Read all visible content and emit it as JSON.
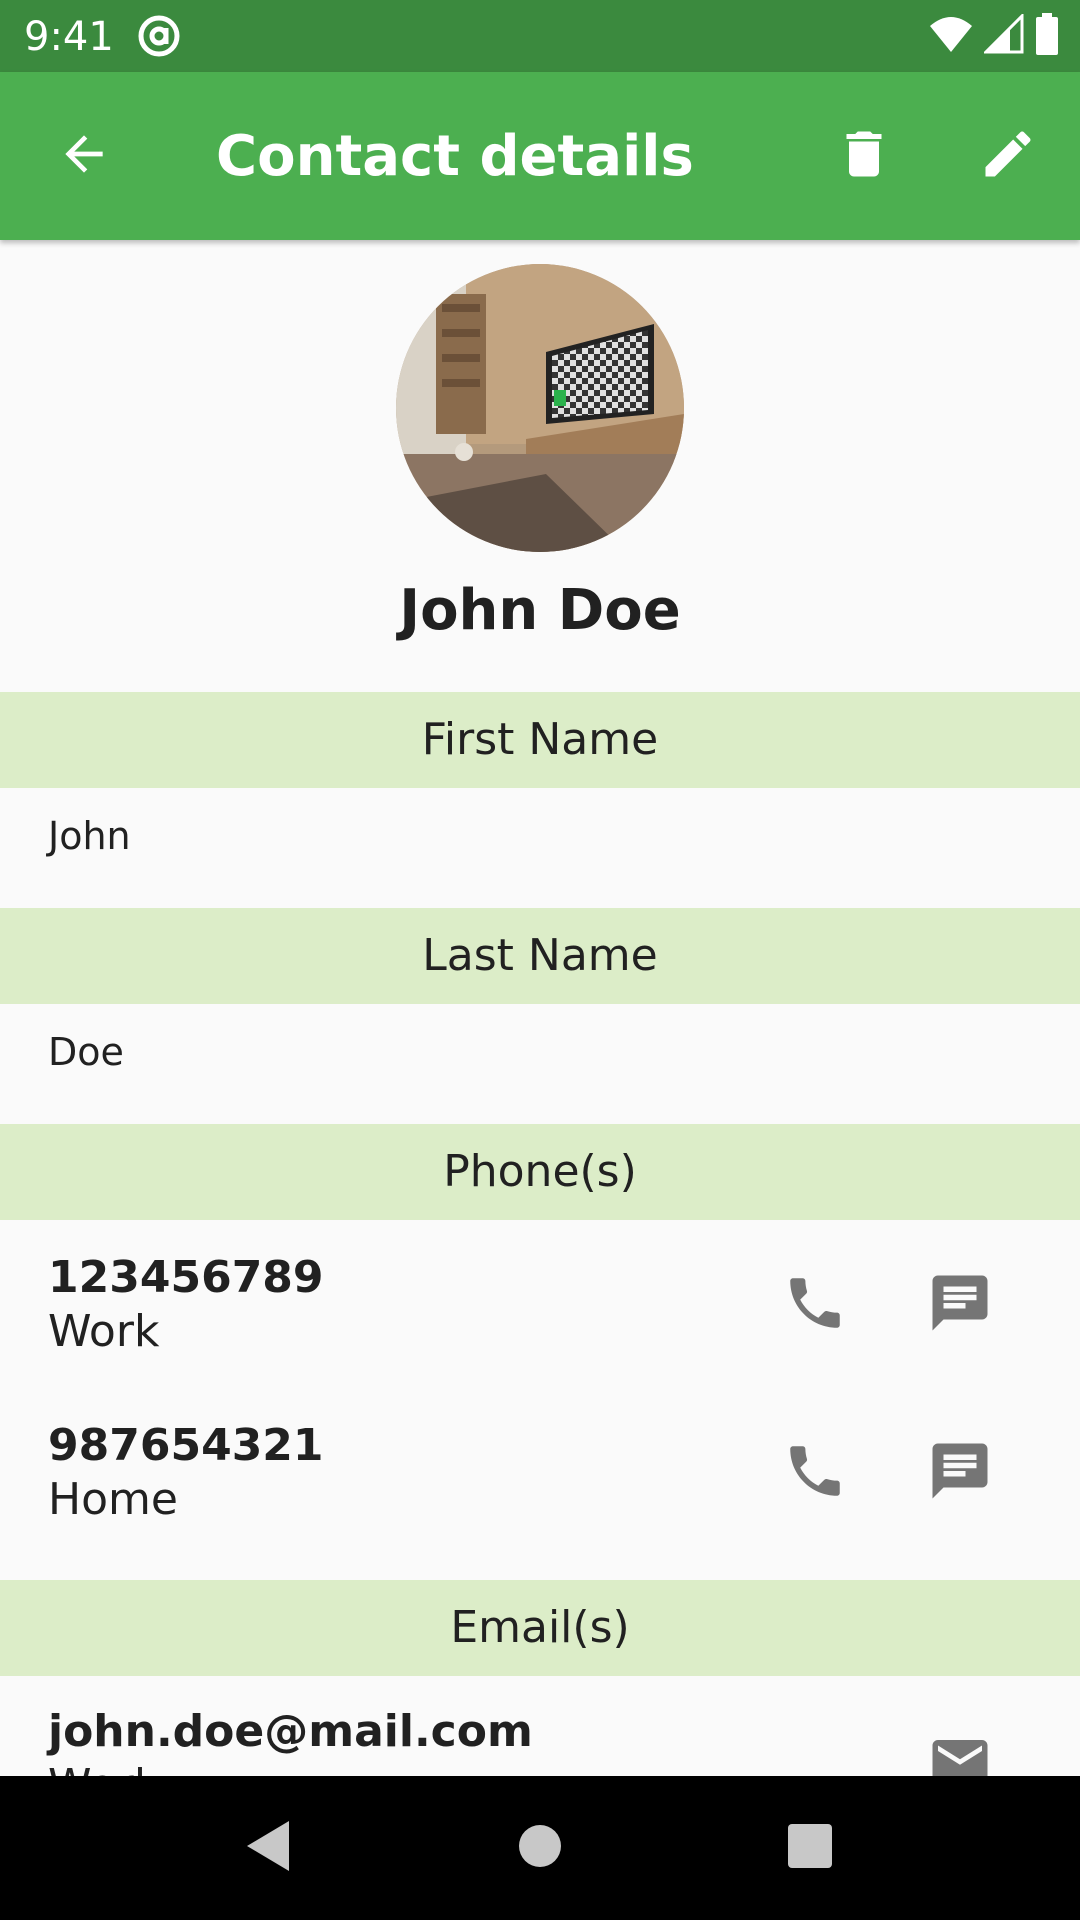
{
  "status_bar": {
    "time": "9:41",
    "icons": [
      "at-sign-icon",
      "wifi-icon",
      "cell-signal-icon",
      "battery-icon"
    ]
  },
  "app_bar": {
    "title": "Contact details",
    "icons": {
      "back": "arrow-back-icon",
      "delete": "trash-icon",
      "edit": "pencil-icon"
    }
  },
  "contact": {
    "display_name": "John Doe"
  },
  "sections": {
    "first_name": {
      "header": "First Name",
      "value": "John"
    },
    "last_name": {
      "header": "Last Name",
      "value": "Doe"
    },
    "phones": {
      "header": "Phone(s)",
      "items": [
        {
          "number": "123456789",
          "label": "Work"
        },
        {
          "number": "987654321",
          "label": "Home"
        }
      ]
    },
    "emails": {
      "header": "Email(s)",
      "items": [
        {
          "address": "john.doe@mail.com",
          "label": "Work"
        }
      ]
    }
  },
  "colors": {
    "status_bar": "#3b8a3e",
    "app_bar": "#4caf50",
    "section_header": "#dcedc8",
    "action_icon": "#757575",
    "background": "#fafafa"
  }
}
